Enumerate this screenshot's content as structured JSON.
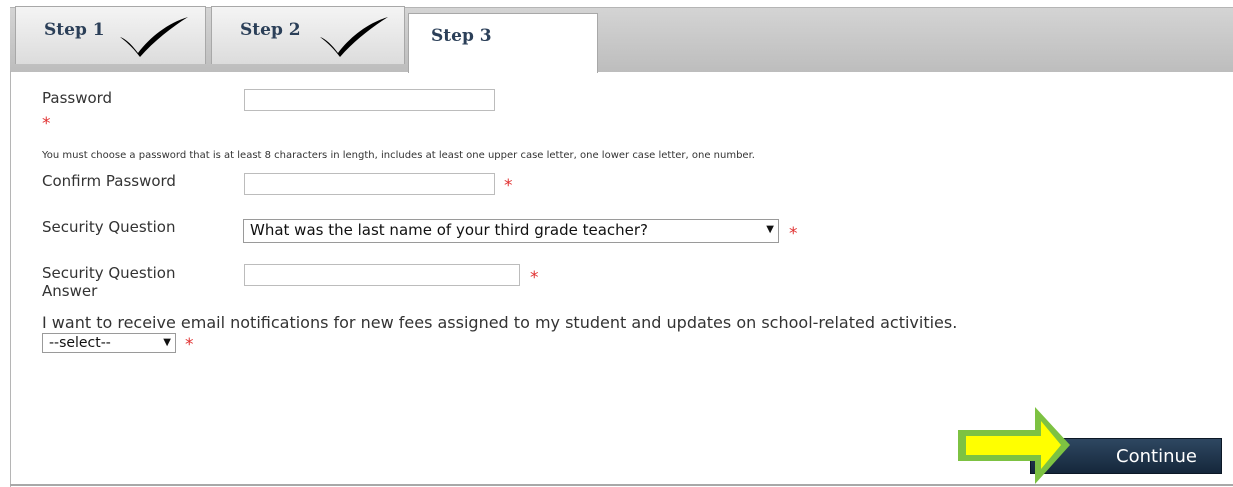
{
  "tabs": [
    {
      "label": "Step 1",
      "completed": true
    },
    {
      "label": "Step 2",
      "completed": true
    },
    {
      "label": "Step 3",
      "completed": false,
      "active": true
    }
  ],
  "form": {
    "password_label": "Password",
    "password_value": "",
    "password_hint": "You must choose a password that is at least 8 characters in length, includes at least one upper case letter, one lower case letter, one number.",
    "confirm_label": "Confirm Password",
    "confirm_value": "",
    "security_question_label": "Security Question",
    "security_question_selected": "What was the last name of your third grade teacher?",
    "security_answer_label_line1": "Security Question",
    "security_answer_label_line2": "Answer",
    "security_answer_value": "",
    "notifications_label": "I want to receive email notifications for new fees assigned to my student and updates on school-related activities.",
    "notifications_selected": "--select--",
    "required_mark": "*"
  },
  "actions": {
    "continue_label": "Continue"
  },
  "colors": {
    "required": "#e03030",
    "button_bg": "#1f354d",
    "arrow_fill": "#ffff00",
    "arrow_border": "#7dc242",
    "tab_text": "#2b3f58"
  },
  "icons": {
    "completed": "checkmark-icon",
    "dropdown": "chevron-down-icon",
    "callout": "arrow-right-icon"
  }
}
